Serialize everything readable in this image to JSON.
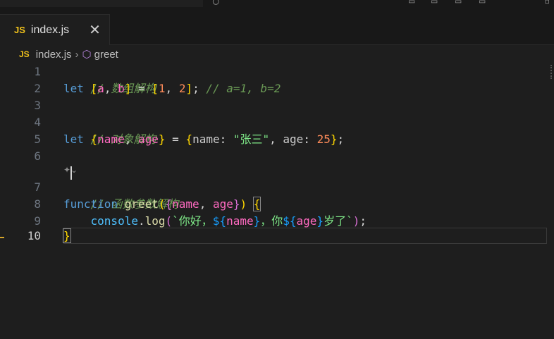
{
  "tab": {
    "lang_badge": "JS",
    "filename": "index.js",
    "close": "✕"
  },
  "breadcrumb": {
    "lang_badge": "JS",
    "file": "index.js",
    "separator": "›",
    "symbol_icon": "⬡",
    "symbol": "greet"
  },
  "codelens": "✦⌄",
  "lines": {
    "n1": "1",
    "n2": "2",
    "n3": "3",
    "n4": "4",
    "n5": "5",
    "n6": "6",
    "n7": "7",
    "n8": "8",
    "n9": "9",
    "n10": "10"
  },
  "code": {
    "l1_comment": "// 数组解构",
    "l2_let": "let ",
    "l2_open": "[",
    "l2_a": "a",
    "l2_comma": ", ",
    "l2_b": "b",
    "l2_close": "]",
    "l2_eq": " = ",
    "l2_open2": "[",
    "l2_one": "1",
    "l2_comma2": ", ",
    "l2_two": "2",
    "l2_close2": "]",
    "l2_semi": ";",
    "l2_comment": " // a=1, b=2",
    "l4_comment": "// 对象解构",
    "l5_let": "let ",
    "l5_open": "{",
    "l5_name": "name",
    "l5_comma": ", ",
    "l5_age": "age",
    "l5_close": "}",
    "l5_eq": " = ",
    "l5_open2": "{",
    "l5_key1": "name",
    "l5_colon1": ": ",
    "l5_val1": "\"张三\"",
    "l5_comma2": ", ",
    "l5_key2": "age",
    "l5_colon2": ": ",
    "l5_val2": "25",
    "l5_close2": "}",
    "l5_semi": ";",
    "l7_comment": "// 函数参数解构",
    "l8_function": "function ",
    "l8_name": "greet",
    "l8_paren": "(",
    "l8_brace": "{",
    "l8_p1": "name",
    "l8_comma": ", ",
    "l8_p2": "age",
    "l8_brace_close": "}",
    "l8_paren_close": ")",
    "l8_space": " ",
    "l8_body_open": "{",
    "l9_indent": "    ",
    "l9_console": "console",
    "l9_dot": ".",
    "l9_log": "log",
    "l9_paren": "(",
    "l9_tpl1": "`你好，",
    "l9_interp1_open": "${",
    "l9_interp1_var": "name",
    "l9_interp1_close": "}",
    "l9_tpl2": "，你",
    "l9_interp2_open": "${",
    "l9_interp2_var": "age",
    "l9_interp2_close": "}",
    "l9_tpl3": "岁了`",
    "l9_paren_close": ")",
    "l9_semi": ";",
    "l10_close": "}"
  }
}
